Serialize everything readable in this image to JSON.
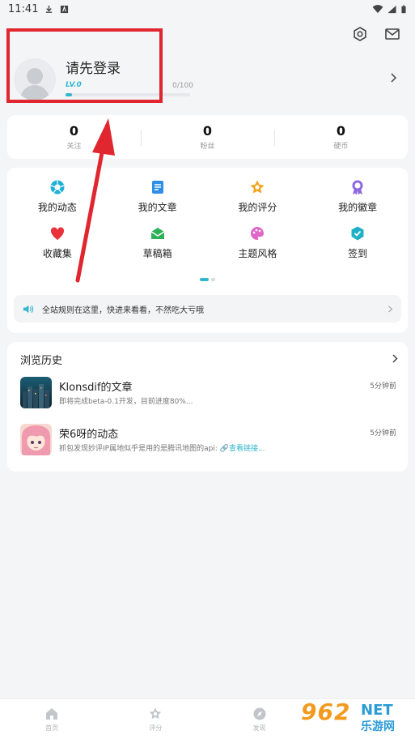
{
  "status_bar": {
    "time": "11:41"
  },
  "profile": {
    "login_prompt": "请先登录",
    "level": "LV.0",
    "exp_text": "0/100",
    "progress_fraction": 0.05
  },
  "stats": [
    {
      "value": "0",
      "label": "关注"
    },
    {
      "value": "0",
      "label": "粉丝"
    },
    {
      "value": "0",
      "label": "硬币"
    }
  ],
  "grid": [
    {
      "label": "我的动态",
      "icon": "shutter-icon",
      "color": "#1fb0d6"
    },
    {
      "label": "我的文章",
      "icon": "document-icon",
      "color": "#2f8ee5"
    },
    {
      "label": "我的评分",
      "icon": "rating-star-icon",
      "color": "#f4a21d"
    },
    {
      "label": "我的徽章",
      "icon": "badge-icon",
      "color": "#8b67e0"
    },
    {
      "label": "收藏集",
      "icon": "heart-icon",
      "color": "#e8313b"
    },
    {
      "label": "草稿箱",
      "icon": "draft-box-icon",
      "color": "#2fb15a"
    },
    {
      "label": "主题风格",
      "icon": "palette-icon",
      "color": "#e067c8"
    },
    {
      "label": "签到",
      "icon": "check-shield-icon",
      "color": "#1fb0c7"
    }
  ],
  "notice": {
    "text": "全站规则在这里，快进来看看，不然吃大亏哦"
  },
  "history": {
    "title": "浏览历史",
    "items": [
      {
        "name": "Klonsdif的文章",
        "desc": "即将完成beta-0.1开发，目前进度80%...",
        "time": "5分钟前"
      },
      {
        "name": "荣6呀的动态",
        "desc": "抓包发现妙评IP属地似乎是用的是腾讯地图的api:",
        "link": "查看链接...",
        "time": "5分钟前"
      }
    ]
  },
  "tabs": [
    {
      "label": "首页",
      "icon": "home-icon"
    },
    {
      "label": "评分",
      "icon": "rating-icon"
    },
    {
      "label": "发现",
      "icon": "compass-icon"
    }
  ],
  "watermark": {
    "num": "962",
    "net": "NET",
    "cn": "乐游网"
  },
  "colors": {
    "accent": "#33b6cf",
    "annotation": "#e0262f"
  }
}
